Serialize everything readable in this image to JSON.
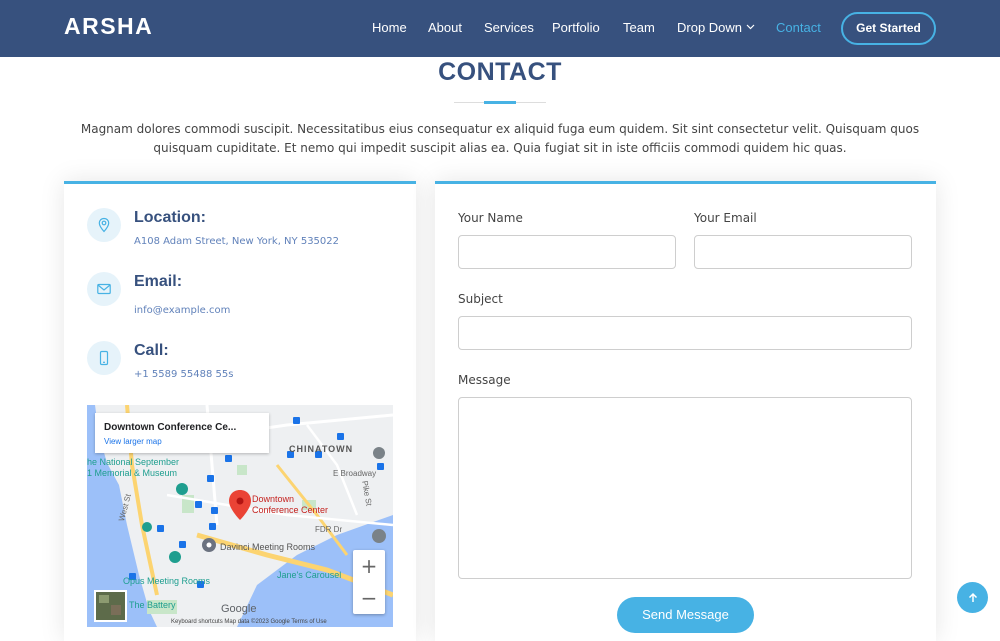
{
  "brand": "ARSHA",
  "nav": {
    "items": [
      {
        "label": "Home",
        "active": false
      },
      {
        "label": "About",
        "active": false
      },
      {
        "label": "Services",
        "active": false
      },
      {
        "label": "Portfolio",
        "active": false
      },
      {
        "label": "Team",
        "active": false
      },
      {
        "label": "Drop Down",
        "active": false,
        "has_dropdown": true
      },
      {
        "label": "Contact",
        "active": true
      }
    ],
    "cta_label": "Get Started"
  },
  "section": {
    "title": "CONTACT",
    "description": "Magnam dolores commodi suscipit. Necessitatibus eius consequatur ex aliquid fuga eum quidem. Sit sint consectetur velit. Quisquam quos quisquam cupiditate. Et nemo qui impedit suscipit alias ea. Quia fugiat sit in iste officiis commodi quidem hic quas."
  },
  "info": {
    "location": {
      "title": "Location:",
      "value": "A108 Adam Street, New York, NY 535022",
      "icon": "map-pin-icon"
    },
    "email": {
      "title": "Email:",
      "value": "info@example.com",
      "icon": "envelope-icon"
    },
    "call": {
      "title": "Call:",
      "value": "+1 5589 55488 55s",
      "icon": "phone-icon"
    }
  },
  "map": {
    "place_name": "Downtown Conference Ce...",
    "view_larger": "View larger map",
    "pin_label_line1": "Downtown",
    "pin_label_line2": "Conference Center",
    "labels": {
      "chinatown": "CHINATOWN",
      "national_sept_1": "he National September",
      "national_sept_2": "1 Memorial & Museum",
      "e_broadway": "E Broadway",
      "fdr": "FDR Dr",
      "davinci": "Davinci Meeting Rooms",
      "opus": "Opus Meeting Rooms",
      "janes": "Jane's Carousel",
      "battery": "The Battery",
      "west_st": "West St",
      "pike_st": "Pike St",
      "google": "Google",
      "attribution": "Keyboard shortcuts    Map data ©2023 Google    Terms of Use"
    },
    "zoom_in": "+",
    "zoom_out": "−"
  },
  "form": {
    "name_label": "Your Name",
    "email_label": "Your Email",
    "subject_label": "Subject",
    "message_label": "Message",
    "name_value": "",
    "email_value": "",
    "subject_value": "",
    "message_value": "",
    "send_label": "Send Message"
  },
  "colors": {
    "header_bg": "#37517e",
    "accent": "#47b2e4",
    "title": "#37517e"
  }
}
